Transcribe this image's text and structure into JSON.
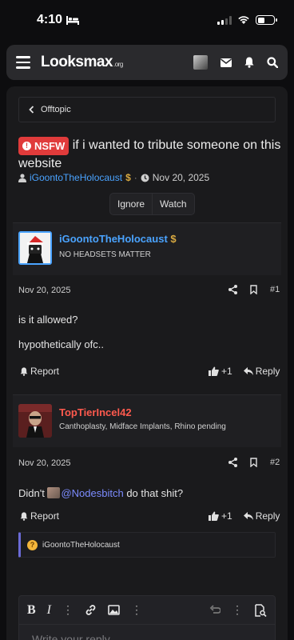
{
  "status": {
    "time": "4:10"
  },
  "nav": {
    "logo_main": "Looksmax",
    "logo_suffix": ".org"
  },
  "breadcrumb": {
    "label": "Offtopic"
  },
  "thread": {
    "badge": "NSFW",
    "title": "if i wanted to tribute someone on this website",
    "author": "iGoontoTheHolocaust",
    "author_badge": "$",
    "date": "Nov 20, 2025",
    "ignore_label": "Ignore",
    "watch_label": "Watch"
  },
  "posts": [
    {
      "username": "iGoontoTheHolocaust",
      "username_badge": "$",
      "user_title": "NO HEADSETS MATTER",
      "date": "Nov 20, 2025",
      "number": "#1",
      "body_line1": "is it allowed?",
      "body_line2": "hypothetically ofc..",
      "report_label": "Report",
      "like_label": "+1",
      "reply_label": "Reply",
      "username_color": "#4aa3ff"
    },
    {
      "username": "TopTierIncel42",
      "user_title": "Canthoplasty, Midface Implants, Rhino pending",
      "date": "Nov 20, 2025",
      "number": "#2",
      "body_prefix": "Didn't ",
      "body_mention": "@Nodesbitch",
      "body_suffix": " do that shit?",
      "report_label": "Report",
      "like_label": "+1",
      "reply_label": "Reply",
      "username_color": "#ff5a4e"
    }
  ],
  "reaction": {
    "user": "iGoontoTheHolocaust",
    "emoji": "thinking-emoji"
  },
  "editor": {
    "placeholder": "Write your reply..."
  },
  "colors": {
    "accent": "#4aa3ff",
    "nsfw": "#e03b3b",
    "mention": "#7c8cff",
    "background": "#1a1a1c"
  }
}
